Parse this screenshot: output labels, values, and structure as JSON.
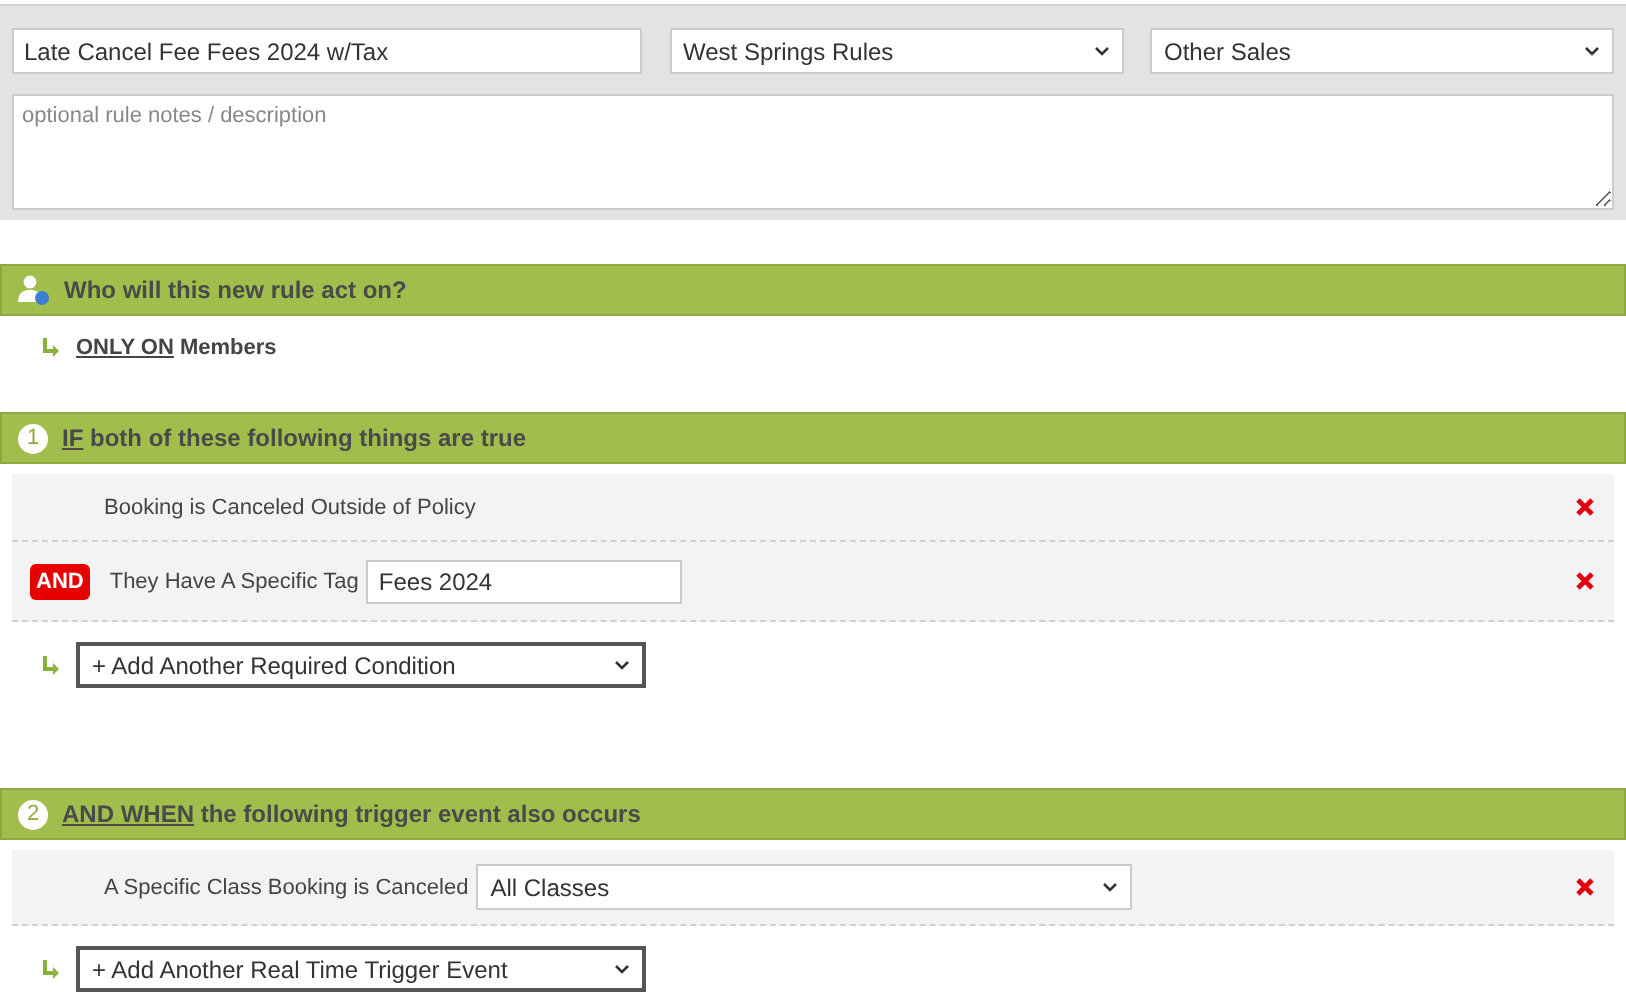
{
  "rule": {
    "name": "Late Cancel Fee Fees 2024 w/Tax",
    "ruleset": "West Springs Rules",
    "category": "Other Sales",
    "notes_placeholder": "optional rule notes / description"
  },
  "audience": {
    "title": "Who will this new rule act on?",
    "keyword": "ONLY ON",
    "target": "Members"
  },
  "sections": [
    {
      "number": "1",
      "keyword": "IF",
      "title": "both of these following things are true",
      "items": [
        {
          "kind": "text",
          "label": "Booking is Canceled Outside of Policy"
        },
        {
          "kind": "input",
          "conjunction": "AND",
          "label": "They Have A Specific Tag",
          "value": "Fees 2024"
        }
      ],
      "add": "+ Add Another Required Condition"
    },
    {
      "number": "2",
      "keyword": "AND WHEN",
      "title": "the following trigger event also occurs",
      "items": [
        {
          "kind": "select",
          "label": "A Specific Class Booking is Canceled",
          "value": "All Classes"
        }
      ],
      "add": "+ Add Another Real Time Trigger Event"
    }
  ]
}
